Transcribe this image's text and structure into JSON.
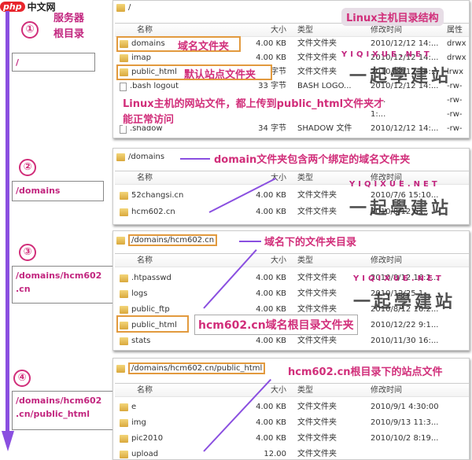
{
  "logo": {
    "brand": "php",
    "site": "中文网"
  },
  "steps": [
    {
      "num": "①",
      "title1": "服务器",
      "title2": "根目录",
      "path": "/"
    },
    {
      "num": "②",
      "path": "/domains"
    },
    {
      "num": "③",
      "path": "/domains/hcm602 .cn"
    },
    {
      "num": "④",
      "path": "/domains/hcm602 .cn/public_html"
    }
  ],
  "watermark": {
    "latin": "YIQIXUE.NET",
    "cjk": "一起學建站"
  },
  "panels": [
    {
      "path": "/",
      "tag": "Linux主机目录结构",
      "headers": {
        "name": "名称",
        "size": "大小",
        "type": "类型",
        "modified": "修改时间",
        "attr": "属性"
      },
      "rows": [
        {
          "icon": "folder",
          "name": "domains",
          "size": "4.00 KB",
          "type": "文件文件夹",
          "modified": "2010/12/12 14:...",
          "attr": "drwx"
        },
        {
          "icon": "folder",
          "name": "imap",
          "size": "4.00 KB",
          "type": "文件文件夹",
          "modified": "2010/12/12 14:...",
          "attr": "drwx"
        },
        {
          "icon": "folder",
          "name": "public_html",
          "size": "字节",
          "type": "文件文件夹",
          "modified": "2010/12/12 14:...",
          "attr": "lrwx"
        },
        {
          "icon": "file",
          "name": ".bash logout",
          "size": "33 字节",
          "type": "BASH LOGO...",
          "modified": "2010/12/12 14:...",
          "attr": "-rw-"
        },
        {
          "icon": "none",
          "name": "",
          "size": "",
          "type": "",
          "modified": "1:...",
          "attr": "-rw-"
        },
        {
          "icon": "none",
          "name": "",
          "size": "",
          "type": "",
          "modified": "1:...",
          "attr": "-rw-"
        },
        {
          "icon": "file",
          "name": ".shadow",
          "size": "34 字节",
          "type": "SHADOW 文件",
          "modified": "2010/12/12 14:...",
          "attr": "-rw-"
        }
      ],
      "annotations": [
        "域名文件夹",
        "默认站点文件夹",
        "Linux主机的网站文件，都上传到public_html文件夹才",
        "能正常访问"
      ]
    },
    {
      "path": "/domains",
      "annotation": "domain文件夹包含两个绑定的域名文件夹",
      "headers": {
        "name": "名称",
        "size": "大小",
        "type": "类型",
        "modified": "修改时间"
      },
      "rows": [
        {
          "icon": "folder",
          "name": "52changsi.cn",
          "size": "4.00 KB",
          "type": "文件文件夹",
          "modified": "2010/7/6 15:10..."
        },
        {
          "icon": "folder",
          "name": "hcm602.cn",
          "size": "4.00 KB",
          "type": "文件文件夹",
          "modified": "2010/8/12 6:..."
        }
      ]
    },
    {
      "path": "/domains/hcm602.cn",
      "annotation": "域名下的文件夹目录",
      "annotation2": "hcm602.cn域名根目录文件夹",
      "headers": {
        "name": "名称",
        "size": "大小",
        "type": "类型",
        "modified": "修改时间"
      },
      "rows": [
        {
          "icon": "folder",
          "name": ".htpasswd",
          "size": "4.00 KB",
          "type": "文件文件夹",
          "modified": "2010/8/12 16:2..."
        },
        {
          "icon": "folder",
          "name": "logs",
          "size": "4.00 KB",
          "type": "文件文件夹",
          "modified": "2010/12/25 1..."
        },
        {
          "icon": "folder",
          "name": "public_ftp",
          "size": "4.00 KB",
          "type": "文件文件夹",
          "modified": "2010/8/12 16:2..."
        },
        {
          "icon": "folder",
          "name": "public_html",
          "size": "",
          "type": "",
          "modified": "2010/12/22 9:1..."
        },
        {
          "icon": "folder",
          "name": "stats",
          "size": "4.00 KB",
          "type": "文件文件夹",
          "modified": "2010/11/30 16:..."
        }
      ]
    },
    {
      "path": "/domains/hcm602.cn/public_html",
      "annotation": "hcm602.cn根目录下的站点文件",
      "headers": {
        "name": "名称",
        "size": "大小",
        "type": "类型",
        "modified": "修改时间"
      },
      "rows": [
        {
          "icon": "folder",
          "name": "e",
          "size": "4.00 KB",
          "type": "文件文件夹",
          "modified": "2010/9/1 4:30:00"
        },
        {
          "icon": "folder",
          "name": "img",
          "size": "4.00 KB",
          "type": "文件文件夹",
          "modified": "2010/9/13 11:3..."
        },
        {
          "icon": "folder",
          "name": "pic2010",
          "size": "4.00 KB",
          "type": "文件文件夹",
          "modified": "2010/10/2 8:19..."
        },
        {
          "icon": "folder",
          "name": "upload",
          "size": "12.00",
          "type": "文件文件夹",
          "modified": ""
        }
      ]
    }
  ],
  "colors": {
    "accent": "#d12e7a",
    "arrow": "#8a4fe0",
    "highlight": "#e29a3e"
  }
}
